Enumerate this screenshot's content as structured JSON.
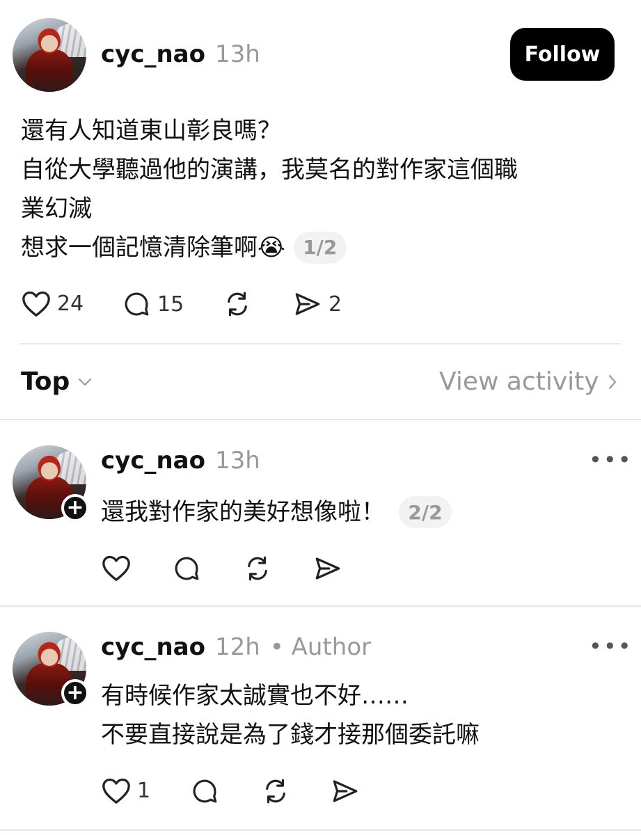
{
  "post": {
    "username": "cyc_nao",
    "time": "13h",
    "follow_label": "Follow",
    "lines": [
      "還有人知道東山彰良嗎？",
      "自從大學聽過他的演講，我莫名的對作家這個職",
      "業幻滅",
      "想求一個記憶清除筆啊😭"
    ],
    "counter": "1/2",
    "likes": "24",
    "comments": "15",
    "shares": "2"
  },
  "filter": {
    "sort_label": "Top",
    "view_activity_label": "View activity"
  },
  "replies": [
    {
      "username": "cyc_nao",
      "time": "13h",
      "text": "還我對作家的美好想像啦！",
      "counter": "2/2"
    },
    {
      "username": "cyc_nao",
      "time": "12h",
      "author_tag": "• Author",
      "lines": [
        "有時候作家太誠實也不好……",
        "不要直接說是為了錢才接那個委託嘛"
      ],
      "likes": "1"
    }
  ]
}
